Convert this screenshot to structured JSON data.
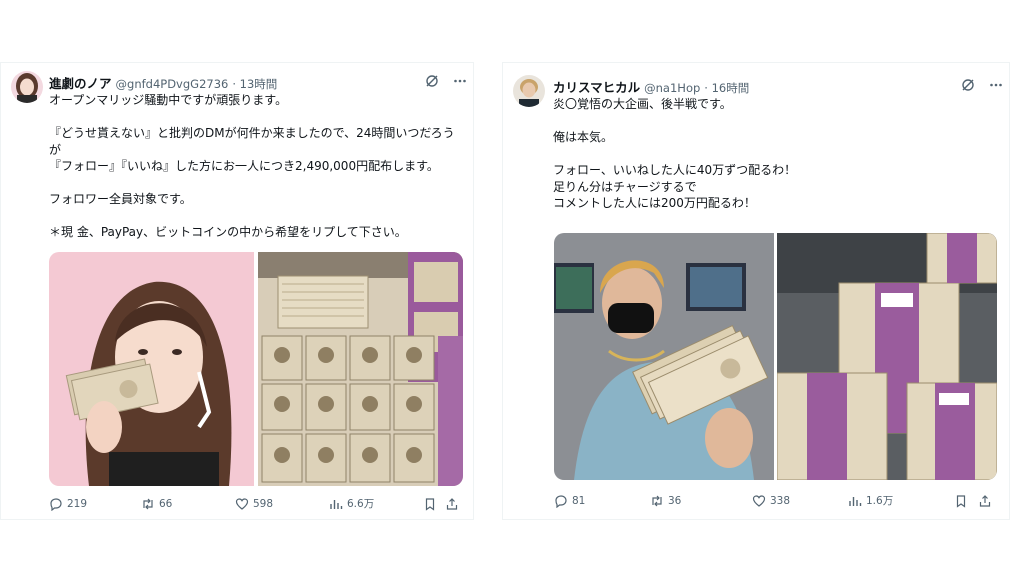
{
  "tweets": [
    {
      "author": "進劇のノア",
      "handle": "@gnfd4PDvgG2736",
      "time": "· 13時間",
      "lines": [
        "オープンマリッジ騒動中ですが頑張ります。",
        "",
        "『どうせ貰えない』と批判のDMが何件か来ましたので、24時間いつだろう",
        "が",
        "『フォロー』『いいね』した方にお一人につき2,490,000円配布します。",
        "",
        "フォロワー全員対象です。",
        "",
        "＊現 金、PayPay、ビットコインの中から希望をリプして下さい。"
      ],
      "replies": "219",
      "reposts": "66",
      "likes": "598",
      "views": "6.6万"
    },
    {
      "author": "カリスマヒカル",
      "handle": "@na1Hop",
      "time": "· 16時間",
      "lines": [
        "炎〇覚悟の大企画、後半戦です。",
        "",
        "俺は本気。",
        "",
        "フォロー、いいねした人に40万ずつ配るわ！",
        "足りん分はチャージするで",
        "コメントした人には200万円配るわ！"
      ],
      "replies": "81",
      "reposts": "36",
      "likes": "338",
      "views": "1.6万"
    }
  ],
  "colors": {
    "text": "#0f1419",
    "muted": "#536471",
    "border": "#eff3f4"
  },
  "icons": [
    "grok-icon",
    "more-icon",
    "reply-icon",
    "repost-icon",
    "like-icon",
    "views-icon",
    "bookmark-icon",
    "share-icon"
  ]
}
